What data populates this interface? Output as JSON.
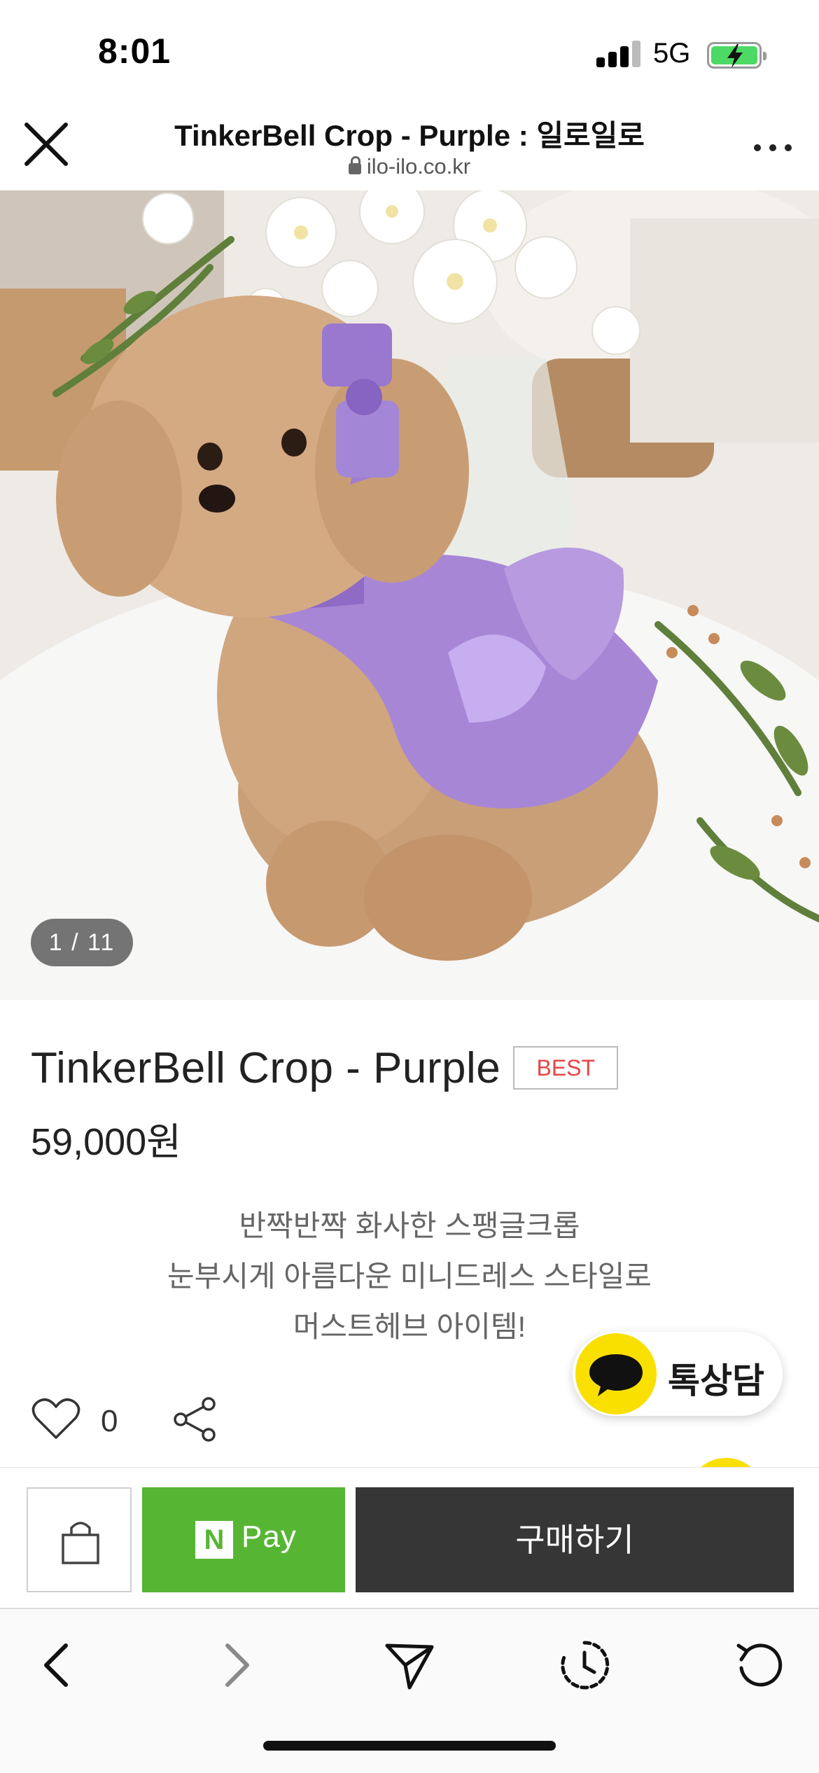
{
  "status_bar": {
    "time": "8:01",
    "network": "5G"
  },
  "browser": {
    "page_title": "TinkerBell Crop - Purple : 일로일로",
    "domain": "ilo-ilo.co.kr",
    "close_icon": "close-icon",
    "more_icon": "more-dots-icon"
  },
  "gallery": {
    "counter": "1 / 11"
  },
  "product": {
    "name": "TinkerBell Crop - Purple",
    "badge": "BEST",
    "price": "59,000원",
    "description": [
      "반짝반짝 화사한 스팽글크롭",
      "눈부시게 아름다운 미니드레스 스타일로",
      "머스트헤브 아이템!"
    ],
    "like_count": "0"
  },
  "talk": {
    "label": "톡상담",
    "color": "#f9e000"
  },
  "purchase": {
    "npay_n": "N",
    "npay_label": "Pay",
    "buy_label": "구매하기",
    "npay_color": "#57b534",
    "buy_color": "#363636"
  },
  "toolbar": {
    "icons": [
      "back-icon",
      "forward-icon",
      "send-icon",
      "history-icon",
      "reload-icon"
    ]
  }
}
